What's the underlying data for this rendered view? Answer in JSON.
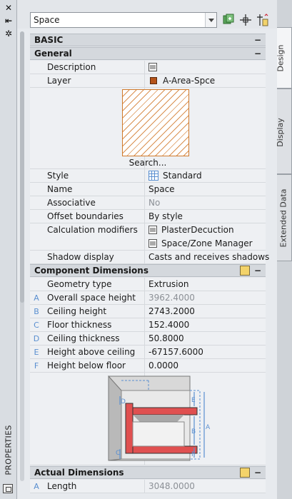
{
  "palette": {
    "title": "PROPERTIES"
  },
  "toolbar": {
    "object_type": "Space"
  },
  "tabs": [
    "Design",
    "Display",
    "Extended Data"
  ],
  "sections": {
    "basic": "BASIC",
    "general": "General",
    "component": "Component Dimensions",
    "actual": "Actual Dimensions"
  },
  "general": {
    "description_label": "Description",
    "layer_label": "Layer",
    "layer_value": "A-Area-Spce",
    "search_label": "Search...",
    "style_label": "Style",
    "style_value": "Standard",
    "name_label": "Name",
    "name_value": "Space",
    "associative_label": "Associative",
    "associative_value": "No",
    "offset_label": "Offset boundaries",
    "offset_value": "By style",
    "calc_label": "Calculation modifiers",
    "calc_value1": "PlasterDecuction",
    "calc_value2": "Space/Zone Manager",
    "shadow_label": "Shadow display",
    "shadow_value": "Casts and receives shadows"
  },
  "component": {
    "geometry_label": "Geometry type",
    "geometry_value": "Extrusion",
    "rows": [
      {
        "idx": "A",
        "label": "Overall space height",
        "value": "3962.4000",
        "readonly": true
      },
      {
        "idx": "B",
        "label": "Ceiling height",
        "value": "2743.2000",
        "readonly": false
      },
      {
        "idx": "C",
        "label": "Floor thickness",
        "value": "152.4000",
        "readonly": false
      },
      {
        "idx": "D",
        "label": "Ceiling thickness",
        "value": "50.8000",
        "readonly": false
      },
      {
        "idx": "E",
        "label": "Height above ceiling",
        "value": "-67157.6000",
        "readonly": false
      },
      {
        "idx": "F",
        "label": "Height below floor",
        "value": "0.0000",
        "readonly": false
      }
    ],
    "diagram_letters": [
      "D",
      "E",
      "B",
      "A",
      "C",
      "F"
    ]
  },
  "actual": {
    "rows": [
      {
        "idx": "A",
        "label": "Length",
        "value": "3048.0000",
        "readonly": true
      }
    ]
  },
  "icons": {
    "close": "close-icon",
    "autohide": "autohide-icon",
    "settings": "settings-icon",
    "add_selection": "add-to-selection-icon",
    "pick": "pick-point-icon",
    "quick_select": "quick-select-icon"
  },
  "colors": {
    "layer_swatch": "#b5531a",
    "hatch": "#d07a2c",
    "accent": "#5a8fd0"
  }
}
